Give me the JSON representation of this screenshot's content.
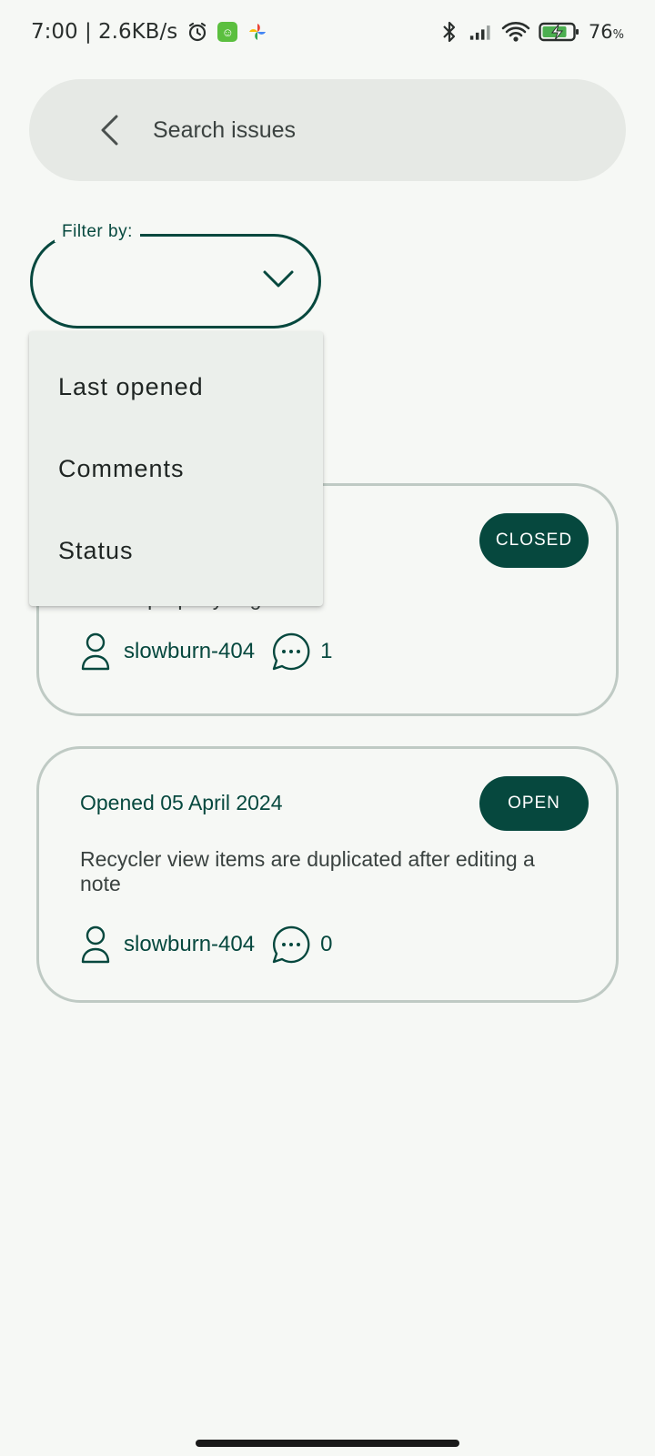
{
  "status_bar": {
    "time": "7:00 | 2.6KB/s",
    "battery": "76",
    "battery_unit": "%",
    "icons": [
      "alarm-icon",
      "app-notification-icon",
      "pinwheel-icon",
      "bluetooth-icon",
      "signal-icon",
      "wifi-icon",
      "battery-charging-icon"
    ]
  },
  "search": {
    "placeholder": "Search issues",
    "value": ""
  },
  "filter": {
    "label": "Filter by:",
    "selected": "",
    "options": [
      "Last opened",
      "Comments",
      "Status"
    ]
  },
  "issues": [
    {
      "date": "",
      "status": "CLOSED",
      "title": "FAB improperly aligned",
      "author": "slowburn-404",
      "comments": "1"
    },
    {
      "date": "Opened 05 April 2024",
      "status": "OPEN",
      "title": "Recycler view items are duplicated after editing a note",
      "author": "slowburn-404",
      "comments": "0"
    }
  ],
  "colors": {
    "accent": "#06483e",
    "background": "#f6f8f5",
    "card_border": "#bfcac4",
    "menu_bg": "#ebefeb"
  }
}
